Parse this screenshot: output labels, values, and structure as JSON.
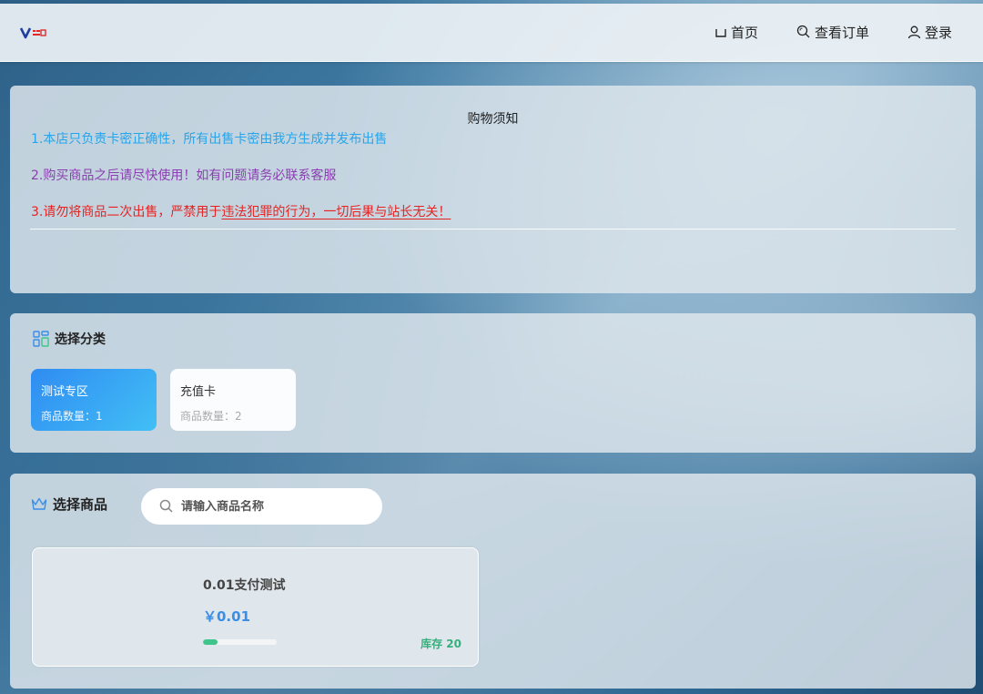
{
  "header": {
    "nav": [
      {
        "label": "首页",
        "icon": "home-icon"
      },
      {
        "label": "查看订单",
        "icon": "search-icon"
      },
      {
        "label": "登录",
        "icon": "user-icon"
      }
    ]
  },
  "notice": {
    "title": "购物须知",
    "line1": "1.本店只负责卡密正确性，所有出售卡密由我方生成并发布出售",
    "line2": "2.购买商品之后请尽快使用！如有问题请务必联系客服",
    "line3_prefix": "3.请勿将商品二次出售，严禁用于",
    "line3_underlined": "违法犯罪的行为，一切后果与站长无关！"
  },
  "category": {
    "title": "选择分类",
    "items": [
      {
        "name": "测试专区",
        "count": "商品数量：1",
        "active": true
      },
      {
        "name": "充值卡",
        "count": "商品数量：2",
        "active": false
      }
    ]
  },
  "goods": {
    "title": "选择商品",
    "search_placeholder": "请输入商品名称",
    "items": [
      {
        "name": "0.01支付测试",
        "price": "￥0.01",
        "stock_label": "库存 20",
        "stock_fraction": 0.2
      }
    ]
  },
  "colors": {
    "notice_line1": "#2aa4e8",
    "notice_line2": "#8a3fb0",
    "notice_line3": "#e52422",
    "active_category_from": "#2f8cf2",
    "active_category_to": "#42bff5",
    "price": "#3a8ee6",
    "stock": "#3fc58a"
  }
}
